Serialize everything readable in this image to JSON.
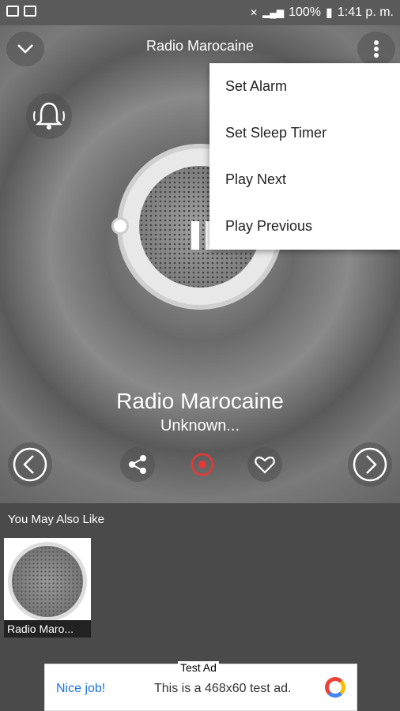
{
  "status_bar": {
    "battery": "100%",
    "time": "1:41 p. m.",
    "signal_icons": [
      "mute-icon",
      "wifi-icon",
      "signal-icon",
      "battery-icon"
    ]
  },
  "header": {
    "title": "Radio Marocaine",
    "icons": [
      "chevron-down-icon",
      "more-vert-icon"
    ]
  },
  "menu": {
    "items": [
      "Set Alarm",
      "Set Sleep Timer",
      "Play Next",
      "Play Previous"
    ]
  },
  "now_playing": {
    "station": "Radio Marocaine",
    "track": "Unknown..."
  },
  "controls": {
    "icons": [
      "alarm-bell-icon",
      "prev-icon",
      "share-icon",
      "record-icon",
      "favorite-icon",
      "next-icon"
    ],
    "record_color": "#e53935"
  },
  "recommendations": {
    "title": "You May Also Like",
    "items": [
      {
        "label": "Radio Maro..."
      }
    ]
  },
  "ad": {
    "tag": "Test Ad",
    "cta": "Nice job!",
    "text": "This is a 468x60 test ad."
  }
}
